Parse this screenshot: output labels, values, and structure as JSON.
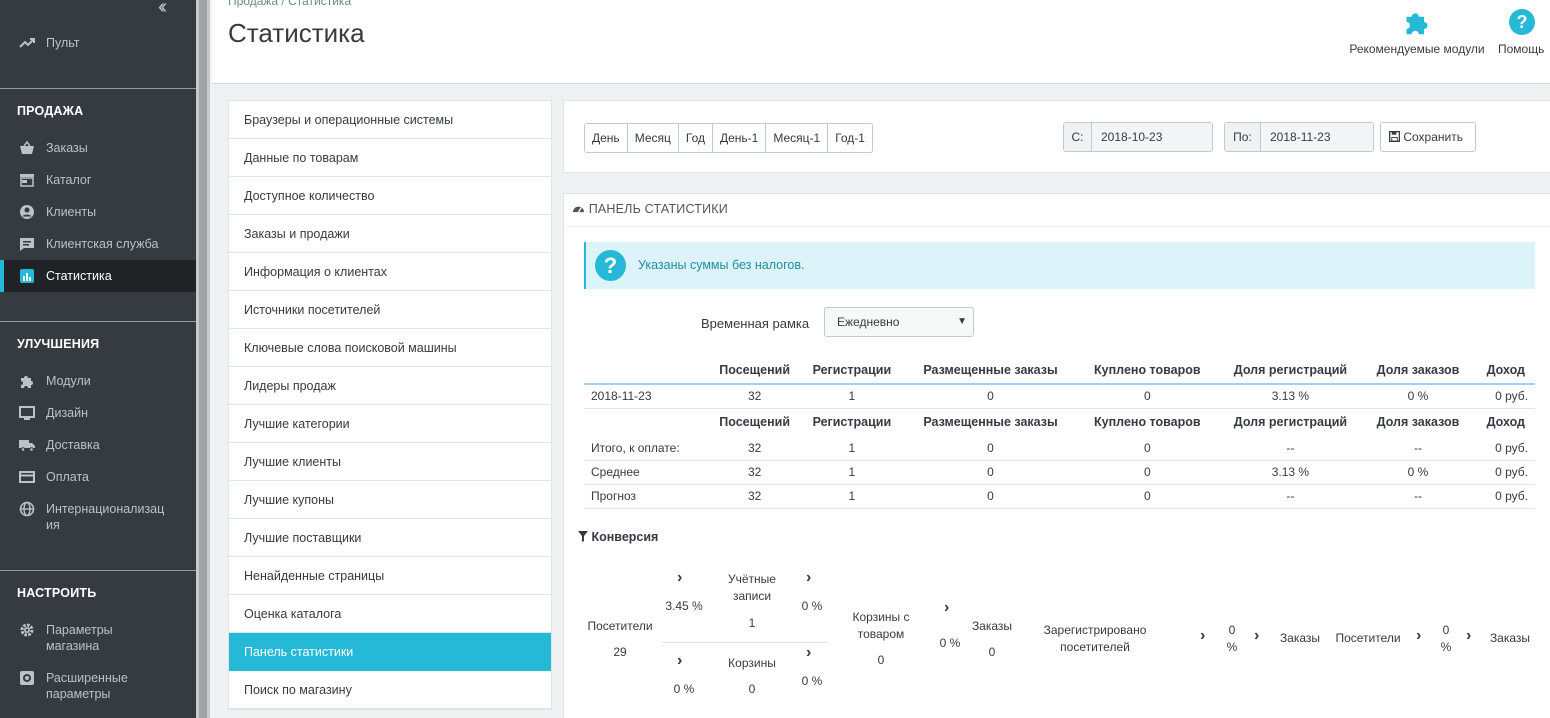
{
  "sidebar": {
    "collapse_icon": "double-chevron-left-icon",
    "dashboard": {
      "label": "Пульт",
      "icon": "trend-icon"
    },
    "sections": [
      {
        "title": "ПРОДАЖА"
      },
      {
        "title": "УЛУЧШЕНИЯ"
      },
      {
        "title": "НАСТРОИТЬ"
      }
    ],
    "items": [
      {
        "label": "Заказы",
        "icon": "basket-icon"
      },
      {
        "label": "Каталог",
        "icon": "store-icon"
      },
      {
        "label": "Клиенты",
        "icon": "user-circle-icon"
      },
      {
        "label": "Клиентская служба",
        "icon": "chat-icon"
      },
      {
        "label": "Статистика",
        "icon": "chart-icon"
      },
      {
        "label": "Модули",
        "icon": "puzzle-icon"
      },
      {
        "label": "Дизайн",
        "icon": "monitor-icon"
      },
      {
        "label": "Доставка",
        "icon": "truck-icon"
      },
      {
        "label": "Оплата",
        "icon": "card-icon"
      },
      {
        "label": "Интернационализац ия",
        "icon": "globe-icon"
      },
      {
        "label": "Параметры магазина",
        "icon": "gear-icon"
      },
      {
        "label": "Расширенные параметры",
        "icon": "settings-box-icon"
      }
    ]
  },
  "header": {
    "breadcrumb": "Продажа  /  Статистика",
    "title": "Статистика",
    "tools": [
      {
        "label": "Рекомендуемые модули",
        "icon": "puzzle-icon"
      },
      {
        "label": "Помощь",
        "icon": "help-icon"
      }
    ]
  },
  "menu": {
    "items": [
      "Браузеры и операционные системы",
      "Данные по товарам",
      "Доступное количество",
      "Заказы и продажи",
      "Информация о клиентах",
      "Источники посетителей",
      "Ключевые слова поисковой машины",
      "Лидеры продаж",
      "Лучшие категории",
      "Лучшие клиенты",
      "Лучшие купоны",
      "Лучшие поставщики",
      "Ненайденные страницы",
      "Оценка каталога",
      "Панель статистики",
      "Поиск по магазину"
    ],
    "active_index": 14
  },
  "datebar": {
    "buttons": [
      "День",
      "Месяц",
      "Год",
      "День-1",
      "Месяц-1",
      "Год-1"
    ],
    "from_label": "С:",
    "from_value": "2018-10-23",
    "to_label": "По:",
    "to_value": "2018-11-23",
    "save_label": "Сохранить",
    "save_icon": "floppy-icon"
  },
  "panel": {
    "title": "ПАНЕЛЬ СТАТИСТИКИ",
    "title_icon": "dashboard-icon",
    "alert_icon": "question-icon",
    "alert_text": "Указаны суммы без налогов.",
    "timeframe_label": "Временная рамка",
    "timeframe_value": "Ежедневно",
    "columns": [
      "",
      "Посещений",
      "Регистрации",
      "Размещенные заказы",
      "Куплено товаров",
      "Доля регистраций",
      "Доля заказов",
      "Доход"
    ],
    "rows": [
      [
        "2018-11-23",
        "32",
        "1",
        "0",
        "0",
        "3.13 %",
        "0 %",
        "0 руб."
      ]
    ],
    "summary_rows": [
      [
        "Итого, к оплате:",
        "32",
        "1",
        "0",
        "0",
        "--",
        "--",
        "0 руб."
      ],
      [
        "Среднее",
        "32",
        "1",
        "0",
        "0",
        "3.13 %",
        "0 %",
        "0 руб."
      ],
      [
        "Прогноз",
        "32",
        "1",
        "0",
        "0",
        "--",
        "--",
        "0 руб."
      ]
    ]
  },
  "conversion": {
    "title": "Конверсия",
    "title_icon": "filter-icon",
    "visitors_label": "Посетители",
    "visitors_value": "29",
    "rate1": "3.45 %",
    "accounts_label": "Учётные записи",
    "accounts_value": "1",
    "rate2": "0 %",
    "rate3": "0 %",
    "carts_label": "Корзины",
    "carts_value": "0",
    "rate4": "0 %",
    "full_carts_label": "Корзины с товаром",
    "full_carts_value": "0",
    "rate5": "0 %",
    "orders_label": "Заказы",
    "orders_value": "0",
    "registered_label": "Зарегистрировано посетителей",
    "rate6": "0 %",
    "orders2_label": "Заказы",
    "visitors2_label": "Посетители",
    "rate7": "0 %",
    "orders3_label": "Заказы"
  }
}
